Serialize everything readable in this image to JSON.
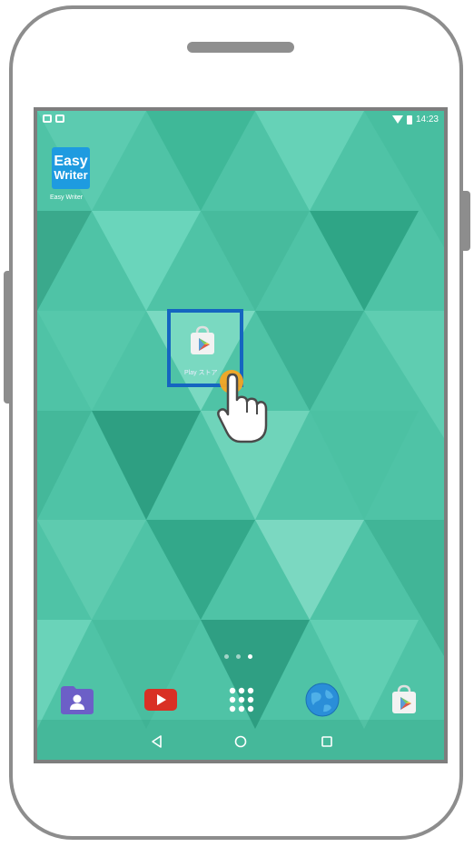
{
  "status_bar": {
    "time": "14:23"
  },
  "home": {
    "apps": [
      {
        "name": "Easy Writer",
        "icon_line1": "Easy",
        "icon_line2": "Writer",
        "icon": "easy-writer-icon"
      },
      {
        "name": "Play ストア",
        "icon": "play-store-icon"
      }
    ],
    "page_indicator": {
      "pages": 3,
      "current": 3
    },
    "dock": [
      {
        "icon": "contacts-icon"
      },
      {
        "icon": "youtube-icon"
      },
      {
        "icon": "app-drawer-icon"
      },
      {
        "icon": "browser-icon"
      },
      {
        "icon": "play-store-icon"
      }
    ]
  },
  "navigation_bar": {
    "buttons": [
      "back-icon",
      "home-icon",
      "recents-icon"
    ]
  },
  "colors": {
    "wallpaper": "#4fc3a6",
    "highlight": "#1565c0",
    "accent_tap": "#f5a623"
  }
}
